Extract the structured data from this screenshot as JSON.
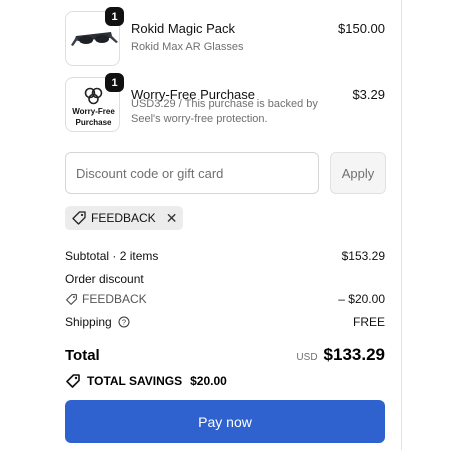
{
  "items": [
    {
      "quantity": "1",
      "name": "Rokid Magic Pack",
      "subtitle": "Rokid Max AR Glasses",
      "price": "$150.00",
      "icon": "ar-glasses-icon"
    },
    {
      "quantity": "1",
      "name": "Worry-Free Purchase",
      "subtitle": "USD3.29 / This purchase is backed by Seel's worry-free protection.",
      "price": "$3.29",
      "thumb_text": "Worry-Free Purchase",
      "icon": "seel-logo-icon"
    }
  ],
  "discount": {
    "placeholder": "Discount code or gift card",
    "value": "",
    "apply_label": "Apply"
  },
  "applied_code": {
    "label": "FEEDBACK",
    "icon": "tag-icon",
    "remove_icon": "close-icon"
  },
  "summary": {
    "subtotal_label": "Subtotal · 2 items",
    "subtotal_value": "$153.29",
    "order_discount_label": "Order discount",
    "discount_code": "FEEDBACK",
    "discount_value": "– $20.00",
    "shipping_label": "Shipping",
    "shipping_value": "FREE",
    "shipping_icon": "help-circle-icon"
  },
  "total": {
    "label": "Total",
    "currency": "USD",
    "amount": "$133.29"
  },
  "savings": {
    "label": "TOTAL SAVINGS",
    "value": "$20.00"
  },
  "pay_button": "Pay now",
  "colors": {
    "primary_button": "#2f62cf",
    "chip_background": "#ececec"
  }
}
